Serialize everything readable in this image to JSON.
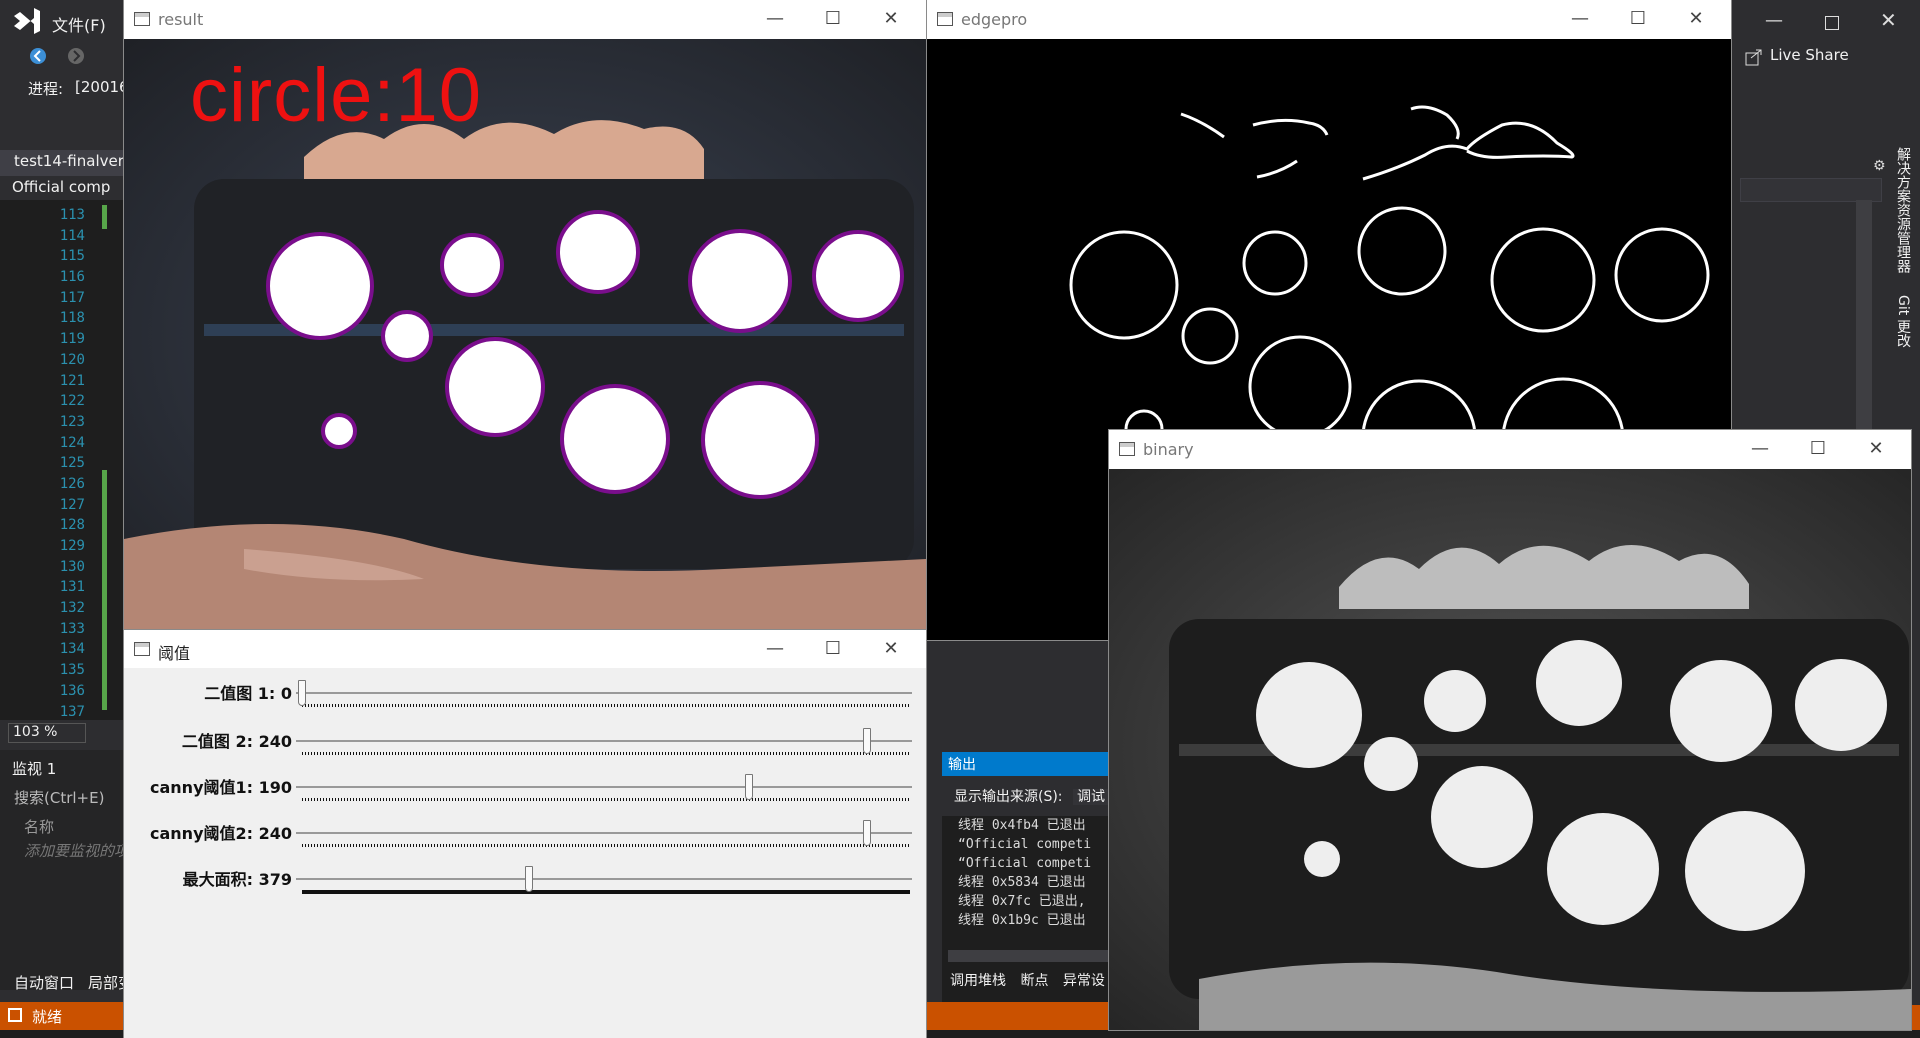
{
  "vs": {
    "menu_file": "文件(F)",
    "process_label": "进程:",
    "process_value": "[20016",
    "doc_tab": "test14-finalvers",
    "nav_dropdown": "Official comp",
    "line_numbers": [
      "113",
      "114",
      "115",
      "116",
      "117",
      "118",
      "119",
      "120",
      "121",
      "122",
      "123",
      "124",
      "125",
      "126",
      "127",
      "128",
      "129",
      "130",
      "131",
      "132",
      "133",
      "134",
      "135",
      "136",
      "137"
    ],
    "zoom": "103 %",
    "watch_title": "监视 1",
    "watch_search": "搜索(Ctrl+E)",
    "watch_col_name": "名称",
    "watch_add_hint": "添加要监视的项",
    "bottom_tab_autos": "自动窗口",
    "bottom_tab_locals": "局部变",
    "status": "就绪",
    "live_share": "Live Share",
    "side_tab_solution": "解决方案资源管理器",
    "side_tab_git": "Git 更改",
    "output_title": "输出",
    "output_source_label": "显示输出来源(S):",
    "output_source_value": "调试",
    "output_lines": [
      "线程 0x4fb4 已退出",
      "“Official competi",
      "“Official competi",
      "线程 0x5834 已退出",
      "线程 0x7fc 已退出,",
      "线程 0x1b9c 已退出"
    ],
    "output_bottom_tabs": [
      "调用堆栈",
      "断点",
      "异常设"
    ]
  },
  "windows": {
    "result": {
      "title": "result",
      "overlay_text": "circle:10"
    },
    "edgepro": {
      "title": "edgepro"
    },
    "binary": {
      "title": "binary"
    },
    "threshold": {
      "title": "阈值",
      "trackbars": [
        {
          "label": "二值图 1: 0",
          "value": 0,
          "max": 255
        },
        {
          "label": "二值图 2: 240",
          "value": 240,
          "max": 255
        },
        {
          "label": "canny阈值1: 190",
          "value": 190,
          "max": 255
        },
        {
          "label": "canny阈值2: 240",
          "value": 240,
          "max": 255
        },
        {
          "label": "最大面积: 379",
          "value": 379,
          "max": 1000
        }
      ]
    }
  },
  "colors": {
    "status_bar": "#ca5100",
    "accent": "#007acc",
    "circle_text": "#ee1111",
    "circle_outline": "#7a0e8c"
  },
  "icons": [
    "vs-logo-icon",
    "back-icon",
    "forward-icon",
    "window-icon",
    "minimize-icon",
    "maximize-icon",
    "close-icon",
    "live-share-icon",
    "settings-icon"
  ]
}
